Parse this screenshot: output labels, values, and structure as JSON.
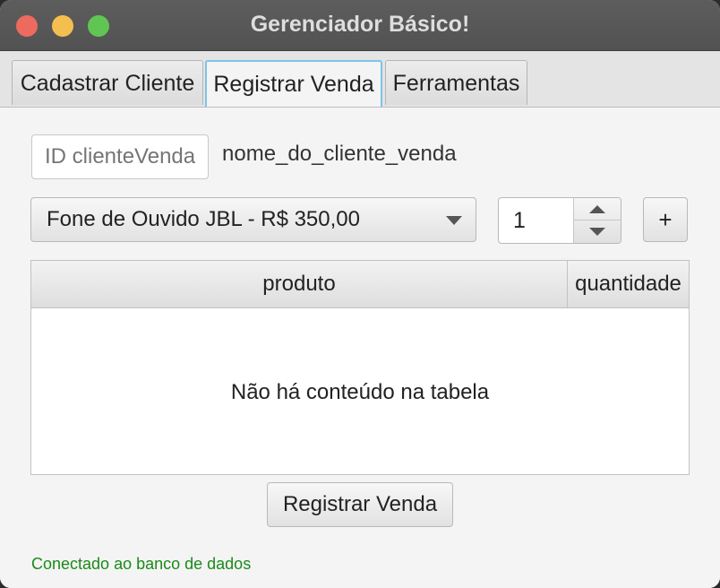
{
  "window": {
    "title": "Gerenciador Básico!"
  },
  "tabs": [
    {
      "label": "Cadastrar Cliente"
    },
    {
      "label": "Registrar Venda",
      "selected": true
    },
    {
      "label": "Ferramentas"
    }
  ],
  "form": {
    "client_id_placeholder": "ID clienteVenda",
    "client_name": "nome_do_cliente_venda",
    "product_selected": "Fone de Ouvido JBL - R$ 350,00",
    "quantity": "1",
    "add_label": "+"
  },
  "table": {
    "columns": [
      "produto",
      "quantidade"
    ],
    "rows": [],
    "empty_message": "Não há conteúdo na tabela"
  },
  "actions": {
    "register_label": "Registrar Venda"
  },
  "status": {
    "text": "Conectado ao banco de dados",
    "color": "#1a8a1a"
  },
  "colors": {
    "active_tab_border": "#7ec3e8",
    "titlebar": "#575757"
  }
}
